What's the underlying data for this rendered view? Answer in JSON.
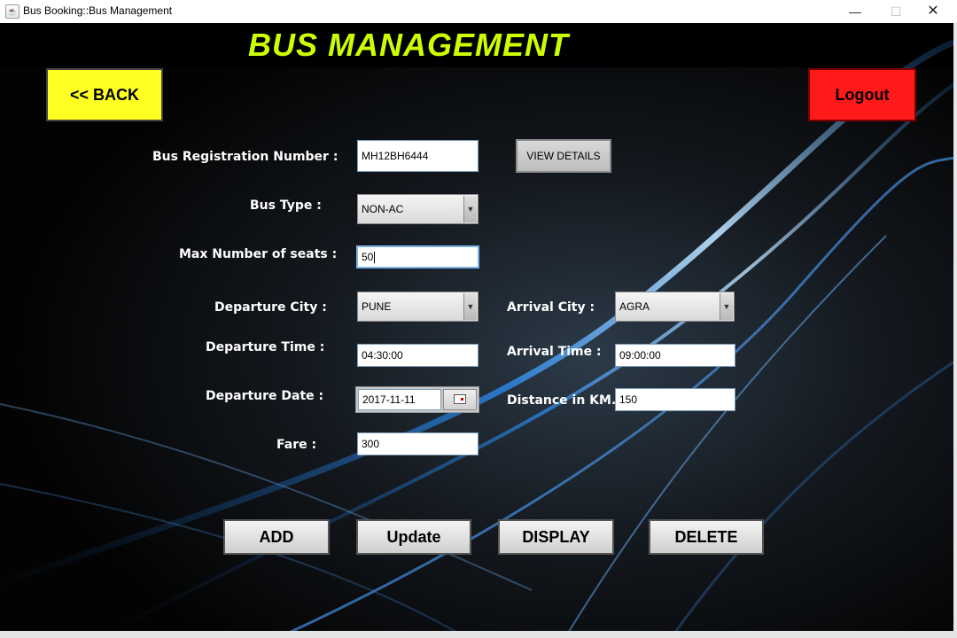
{
  "window": {
    "title": "Bus Booking::Bus Management",
    "app_icon": "java-icon",
    "minimize": "—",
    "maximize": "☐",
    "close": "✕"
  },
  "header": {
    "title": "BUS MANAGEMENT"
  },
  "nav": {
    "back_label": "<< BACK",
    "logout_label": "Logout"
  },
  "form": {
    "reg_label": "Bus Registration Number :",
    "reg_value": "MH12BH6444",
    "view_details_label": "VIEW DETAILS",
    "bus_type_label": "Bus Type :",
    "bus_type_value": "NON-AC",
    "seats_label": "Max Number of seats :",
    "seats_value": "50",
    "dep_city_label": "Departure City :",
    "dep_city_value": "PUNE",
    "arr_city_label": "Arrival City :",
    "arr_city_value": "AGRA",
    "dep_time_label": "Departure Time :",
    "dep_time_value": "04:30:00",
    "arr_time_label": "Arrival Time :",
    "arr_time_value": "09:00:00",
    "dep_date_label": "Departure Date :",
    "dep_date_value": "2017-11-11",
    "distance_label": "Distance in KM. :",
    "distance_value": "150",
    "fare_label": "Fare :",
    "fare_value": "300"
  },
  "actions": {
    "add": "ADD",
    "update": "Update",
    "display": "DISPLAY",
    "delete": "DELETE"
  },
  "colors": {
    "title": "#ccff00",
    "back": "#ffff22",
    "logout": "#ff1a1a"
  }
}
